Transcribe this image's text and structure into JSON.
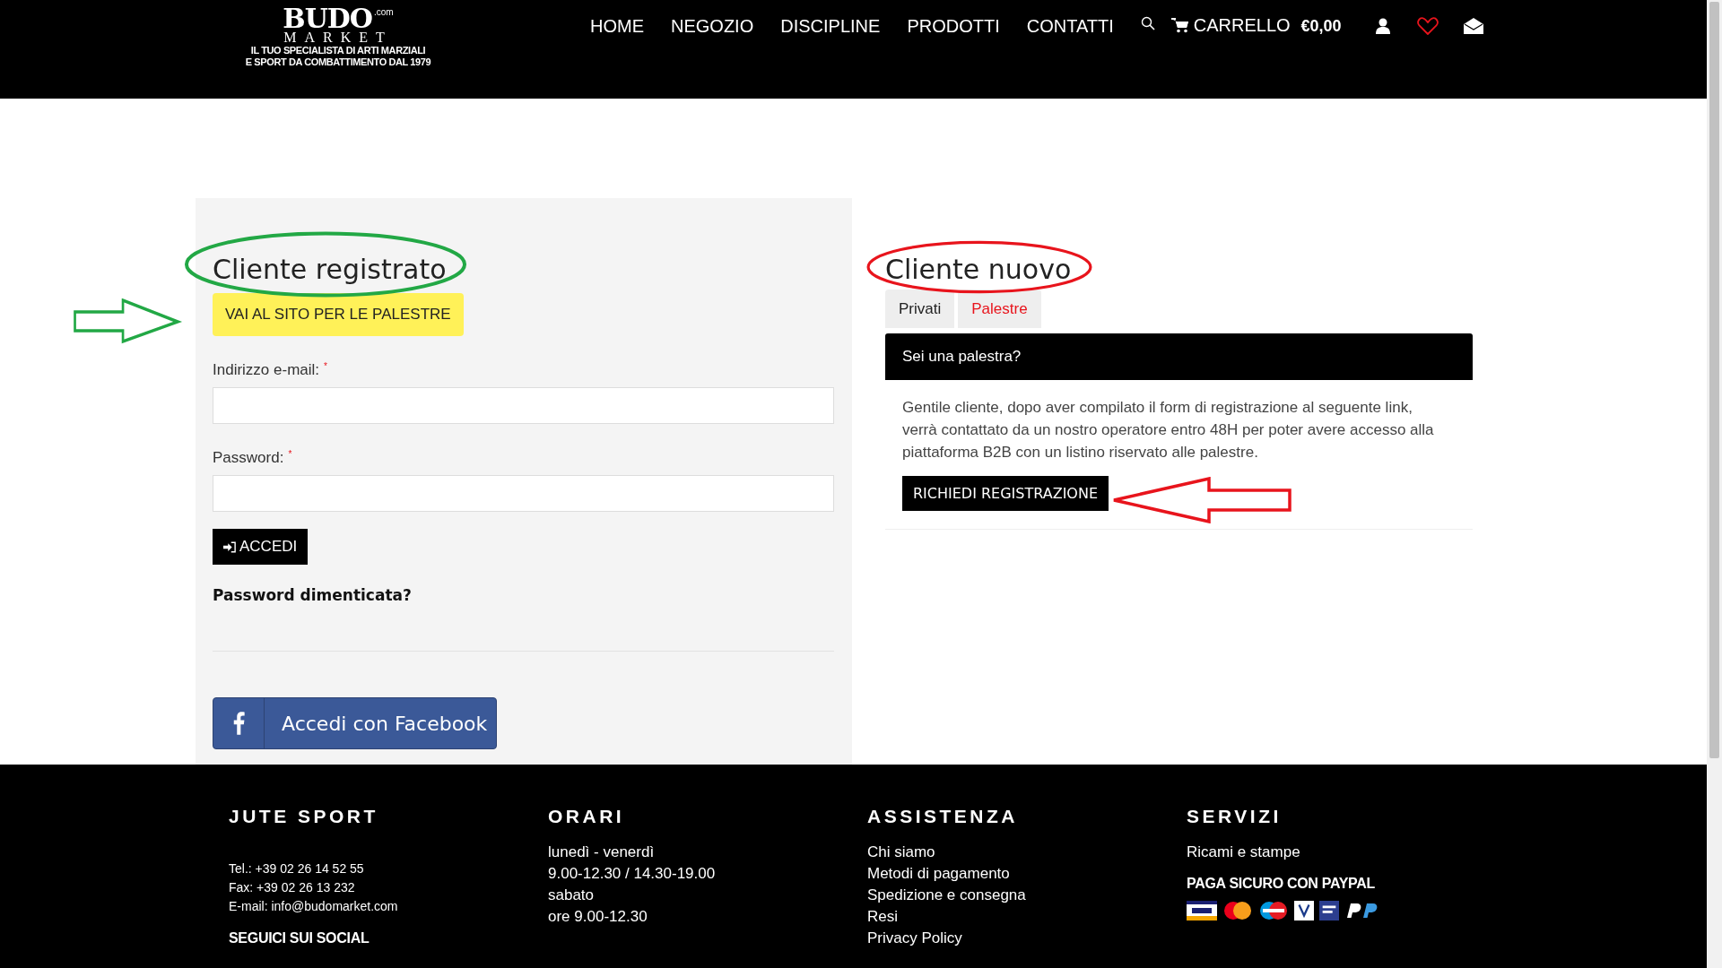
{
  "logo": {
    "title": "BUDO",
    "subtitle": "MARKET",
    "suffix": ".com",
    "tagline": [
      "IL TUO SPECIALISTA DI ARTI MARZIALI",
      "E SPORT DA COMBATTIMENTO DAL 1979"
    ]
  },
  "nav": {
    "items": [
      "HOME",
      "NEGOZIO",
      "DISCIPLINE",
      "PRODOTTI",
      "CONTATTI"
    ],
    "cart_label": "CARRELLO",
    "cart_total": "€0,00"
  },
  "login": {
    "title": "Cliente registrato",
    "gym_button": "VAI AL SITO PER LE PALESTRE",
    "email_label": "Indirizzo e-mail:",
    "password_label": "Password:",
    "required_mark": "*",
    "submit": "ACCEDI",
    "forgot": "Password dimenticata?",
    "facebook": "Accedi con Facebook"
  },
  "register": {
    "title": "Cliente nuovo",
    "tabs": [
      {
        "label": "Privati",
        "selected": false
      },
      {
        "label": "Palestre",
        "selected": true
      }
    ],
    "panel_title": "Sei una palestra?",
    "panel_text": "Gentile cliente, dopo aver compilato il form di registrazione al seguente link, verrà contattato da un nostro operatore entro 48H per poter avere accesso alla piattaforma B2B con un listino riservato alle palestre.",
    "panel_button": "RICHIEDI REGISTRAZIONE"
  },
  "annotations": [
    {
      "kind": "ellipse",
      "color": "#22a845"
    },
    {
      "kind": "arrow",
      "color": "#22a845"
    },
    {
      "kind": "ellipse",
      "color": "#e8141c"
    },
    {
      "kind": "arrow",
      "color": "#e8141c"
    }
  ],
  "footer": {
    "columns": [
      {
        "title": "JUTE SPORT",
        "lines": [
          "Tel.: +39 02 26 14 52 55",
          "Fax: +39 02 26 13 232",
          "E-mail: info@budomarket.com"
        ],
        "subtitle": "SEGUICI SUI SOCIAL"
      },
      {
        "title": "ORARI",
        "lines": [
          "lunedì - venerdì",
          "9.00-12.30 / 14.30-19.00",
          "sabato",
          "ore 9.00-12.30"
        ]
      },
      {
        "title": "ASSISTENZA",
        "lines": [
          "Chi siamo",
          "Metodi di pagamento",
          "Spedizione e consegna",
          "Resi",
          "Privacy Policy"
        ]
      },
      {
        "title": "SERVIZI",
        "lines": [
          "Ricami e stampe"
        ],
        "subtitle": "PAGA SICURO CON PAYPAL"
      }
    ]
  }
}
